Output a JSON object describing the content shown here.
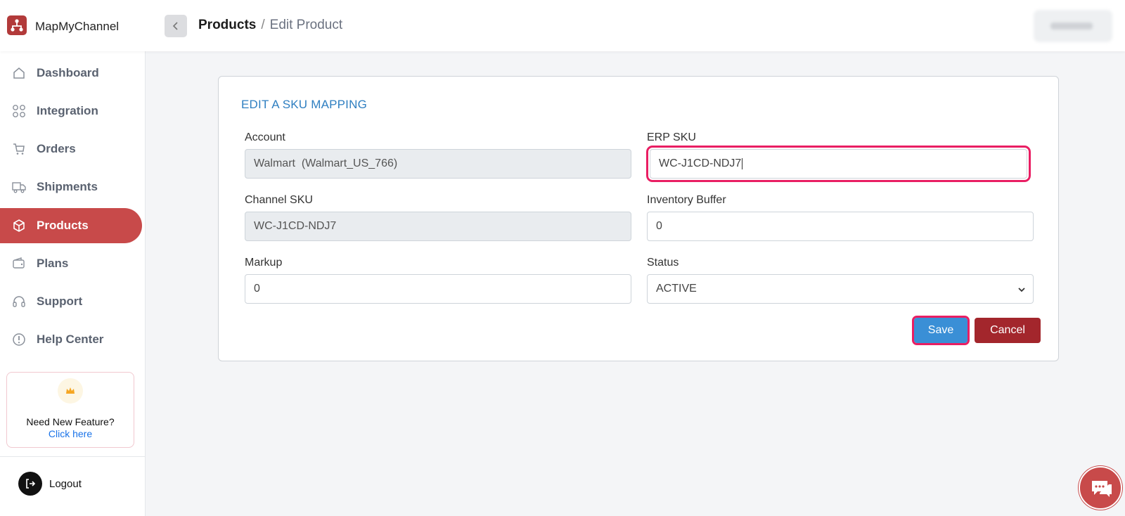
{
  "app": {
    "title": "MapMyChannel"
  },
  "breadcrumb": {
    "current": "Products",
    "separator": "/",
    "page": "Edit Product"
  },
  "sidebar": {
    "items": [
      {
        "label": "Dashboard",
        "icon": "home-icon",
        "active": false
      },
      {
        "label": "Integration",
        "icon": "grid-icon",
        "active": false
      },
      {
        "label": "Orders",
        "icon": "cart-icon",
        "active": false
      },
      {
        "label": "Shipments",
        "icon": "truck-icon",
        "active": false
      },
      {
        "label": "Products",
        "icon": "box-icon",
        "active": true
      },
      {
        "label": "Plans",
        "icon": "wallet-icon",
        "active": false
      },
      {
        "label": "Support",
        "icon": "headset-icon",
        "active": false
      },
      {
        "label": "Help Center",
        "icon": "info-icon",
        "active": false
      }
    ],
    "feature": {
      "title": "Need New Feature?",
      "link": "Click here",
      "icon": "crown-icon"
    },
    "logout": {
      "label": "Logout",
      "icon": "logout-icon"
    }
  },
  "form": {
    "heading": "EDIT A SKU MAPPING",
    "account": {
      "label": "Account",
      "value": "Walmart  (Walmart_US_766)"
    },
    "erp_sku": {
      "label": "ERP SKU",
      "value": "WC-J1CD-NDJ7"
    },
    "channel_sku": {
      "label": "Channel SKU",
      "value": "WC-J1CD-NDJ7"
    },
    "inventory_buffer": {
      "label": "Inventory Buffer",
      "value": "0"
    },
    "markup": {
      "label": "Markup",
      "value": "0"
    },
    "status": {
      "label": "Status",
      "value": "ACTIVE"
    },
    "save_label": "Save",
    "cancel_label": "Cancel"
  },
  "colors": {
    "brand": "#c84a4a",
    "heading": "#2f7fc1",
    "save": "#3a8fd6",
    "cancel": "#a3262c",
    "highlight": "#e91e63"
  },
  "chat": {
    "icon": "chat-icon"
  }
}
